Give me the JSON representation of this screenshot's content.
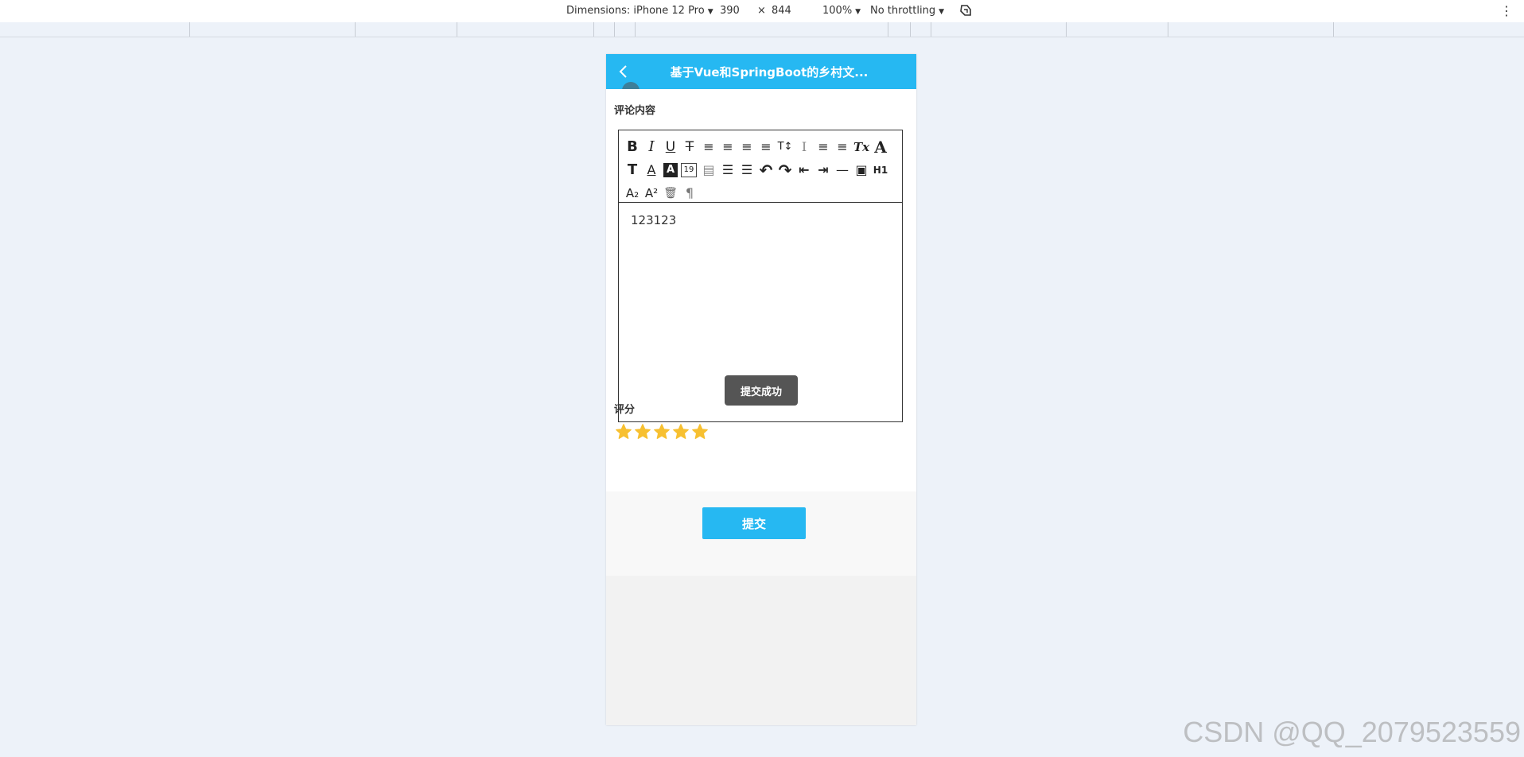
{
  "devtools": {
    "dimensions_label": "Dimensions: iPhone 12 Pro",
    "width": "390",
    "times": "×",
    "height": "844",
    "zoom": "100%",
    "throttling": "No throttling"
  },
  "header": {
    "title": "基于Vue和SpringBoot的乡村文..."
  },
  "form": {
    "comment_label": "评论内容",
    "comment_text": "123123",
    "rating_label": "评分",
    "rating": 5,
    "rating_max": 5,
    "submit_label": "提交"
  },
  "toast": {
    "message": "提交成功"
  },
  "toolbar": {
    "row1": [
      "B",
      "I",
      "U",
      "T",
      "≡",
      "≡",
      "≡",
      "≡",
      "T↕",
      "I",
      "≡",
      "≡",
      "Tx",
      "A"
    ],
    "row2": [
      "T",
      "A",
      "A",
      "19",
      "▤",
      "☰",
      "☰",
      "↶",
      "↷",
      "⇤",
      "⇥",
      "—",
      "▣",
      "H1"
    ],
    "row3": [
      "A₂",
      "A²",
      "🗑",
      "¶"
    ]
  },
  "watermark": "CSDN @QQ_2079523559",
  "colors": {
    "primary": "#26b8f2",
    "star": "#f7c031",
    "toast": "#555555"
  }
}
